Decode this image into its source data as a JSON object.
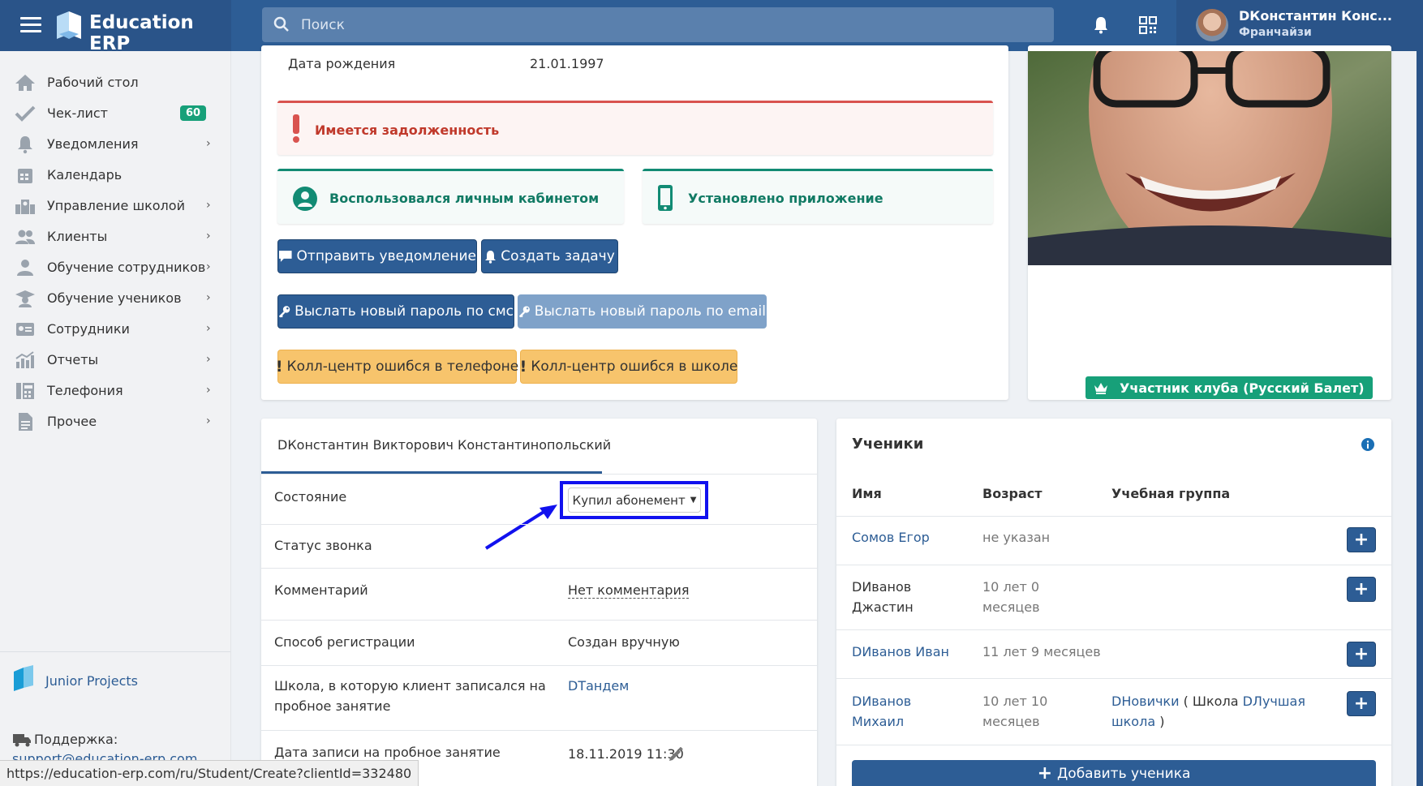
{
  "app": {
    "title": "Education ERP"
  },
  "search": {
    "placeholder": "Поиск"
  },
  "user": {
    "name": "DКонстантин Конс...",
    "role": "Франчайзи"
  },
  "sidebar": {
    "items": [
      {
        "label": "Рабочий стол",
        "icon": "home-icon"
      },
      {
        "label": "Чек-лист",
        "icon": "check-icon",
        "badge": "60"
      },
      {
        "label": "Уведомления",
        "icon": "bell-icon",
        "chevron": "›"
      },
      {
        "label": "Календарь",
        "icon": "calendar-icon"
      },
      {
        "label": "Управление школой",
        "icon": "school-icon",
        "chevron": "›"
      },
      {
        "label": "Клиенты",
        "icon": "users-icon",
        "chevron": "›"
      },
      {
        "label": "Обучение сотрудников",
        "icon": "staff-training-icon",
        "chevron": "›"
      },
      {
        "label": "Обучение учеников",
        "icon": "graduation-cap-icon",
        "chevron": "›"
      },
      {
        "label": "Сотрудники",
        "icon": "id-card-icon",
        "chevron": "›"
      },
      {
        "label": "Отчеты",
        "icon": "chart-icon",
        "chevron": "›"
      },
      {
        "label": "Телефония",
        "icon": "phone-book-icon",
        "chevron": "›"
      },
      {
        "label": "Прочее",
        "icon": "document-icon",
        "chevron": "›"
      }
    ],
    "junior_label": "Junior Projects",
    "support_label": "Поддержка:",
    "support_email": "support@education-erp.com"
  },
  "status_url": "https://education-erp.com/ru/Student/Create?clientId=332480",
  "profile": {
    "birth_label": "Дата рождения",
    "birth_value": "21.01.1997",
    "debt_alert": "Имеется задолженность",
    "cabinet_info": "Воспользовался личным кабинетом",
    "app_info": "Установлено приложение",
    "buttons": {
      "send_notification": "Отправить уведомление",
      "create_task": "Создать задачу",
      "password_sms": "Выслать новый пароль по смс",
      "password_email": "Выслать новый пароль по email",
      "callcenter_phone": "Колл-центр ошибся в телефоне",
      "callcenter_school": "Колл-центр ошибся в школе"
    },
    "club_badge": "Участник клуба (Русский Балет)"
  },
  "client": {
    "name": "DКонстантин Викторович Константинопольский",
    "rows": {
      "state_label": "Состояние",
      "state_value": "Купил абонемент",
      "call_status_label": "Статус звонка",
      "comment_label": "Комментарий",
      "comment_value": "Нет комментария",
      "reg_method_label": "Способ регистрации",
      "reg_method_value": "Создан вручную",
      "school_label_1": "Школа, в которую клиент записался на",
      "school_label_2": "пробное занятие",
      "school_value": "DТандем",
      "trial_date_label": "Дата записи на пробное занятие",
      "trial_date_value": "18.11.2019 11:30"
    }
  },
  "students": {
    "title": "Ученики",
    "columns": {
      "name": "Имя",
      "age": "Возраст",
      "group": "Учебная группа"
    },
    "rows": [
      {
        "name_1": "Сомов Егор",
        "age_1": "не указан"
      },
      {
        "name_1": "DИванов",
        "name_2": "Джастин",
        "age_1": "10 лет 0",
        "age_2": "месяцев"
      },
      {
        "name_1": "DИванов Иван",
        "age_1": "11 лет 9 месяцев"
      },
      {
        "name_1": "DИванов",
        "name_2": "Михаил",
        "age_1": "10 лет 10",
        "age_2": "месяцев",
        "group_link": "DНовички",
        "group_school_prefix": "( Школа",
        "group_school_link_1": "DЛучшая",
        "group_school_link_2": "школа",
        "group_close": ")"
      }
    ],
    "add_button": "Добавить ученика"
  },
  "colors": {
    "primary": "#2d5d95",
    "success": "#17a079",
    "danger": "#d9534f",
    "warning": "#f7c46c",
    "highlight": "#1111ee"
  }
}
